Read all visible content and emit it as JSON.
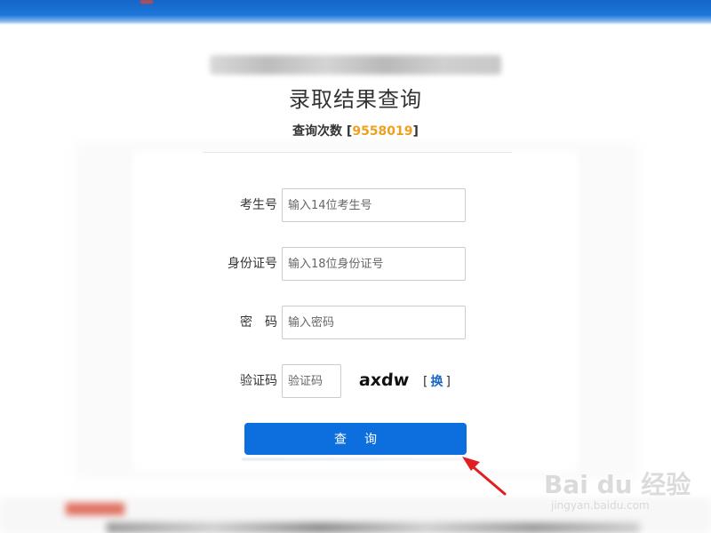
{
  "page": {
    "title": "录取结果查询",
    "query_count_label": "查询次数",
    "query_count_value": "9558019",
    "bracket_open": "[",
    "bracket_close": "]"
  },
  "form": {
    "exam_number": {
      "label": "考生号",
      "placeholder": "输入14位考生号",
      "value": ""
    },
    "id_number": {
      "label": "身份证号",
      "placeholder": "输入18位身份证号",
      "value": ""
    },
    "password": {
      "label": "密　码",
      "placeholder": "输入密码",
      "value": ""
    },
    "captcha": {
      "label": "验证码",
      "placeholder": "验证码",
      "value": "",
      "image_text": "axdw",
      "refresh_label": "换"
    },
    "submit_label": "查询"
  },
  "watermark": {
    "text": "Bai du 经验",
    "sub": "jingyan.baidu.com"
  },
  "colors": {
    "top_bar": "#1565c8",
    "button": "#0d6fdd",
    "count_value": "#f0a020",
    "refresh_link": "#1a66c2",
    "arrow": "#e02020"
  },
  "icons": {
    "annotation": "red-arrow-icon"
  }
}
